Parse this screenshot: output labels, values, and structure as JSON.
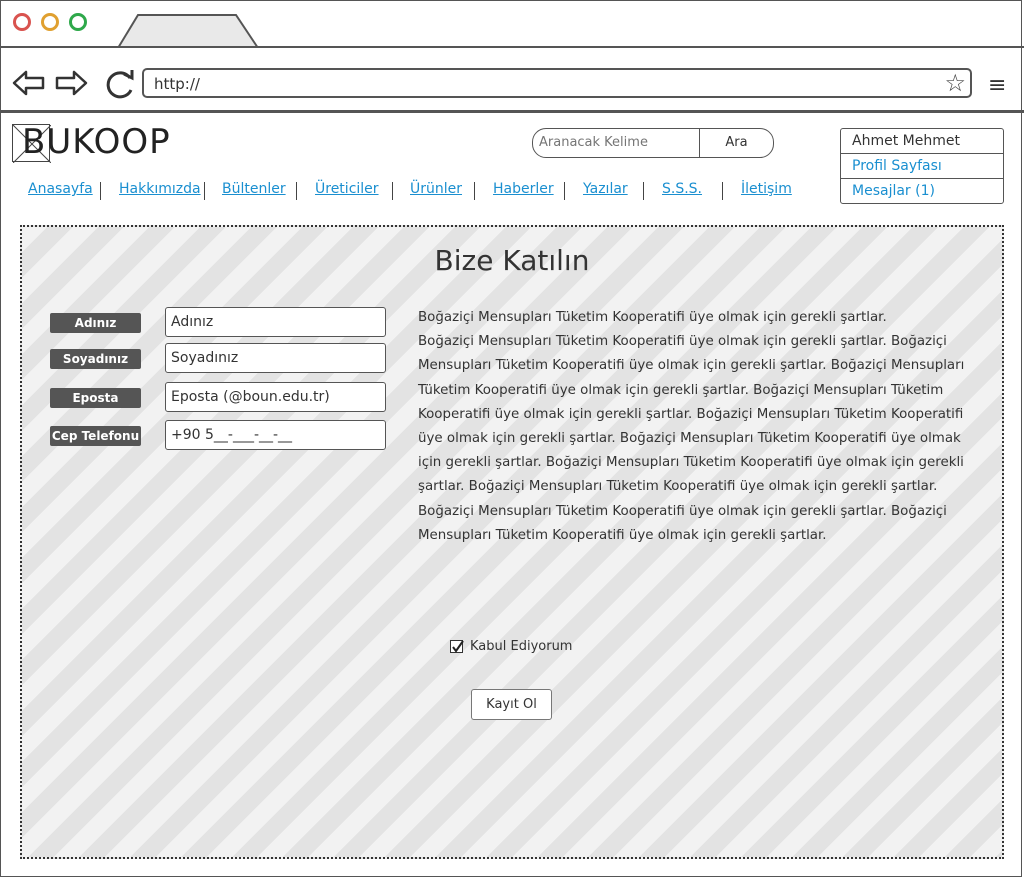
{
  "browser": {
    "url": "http://",
    "icons": [
      "back-arrow-icon",
      "forward-arrow-icon",
      "reload-icon",
      "star-icon",
      "hamburger-menu-icon"
    ]
  },
  "header": {
    "logo_text": "BUKOOP",
    "search": {
      "placeholder": "Aranacak Kelime",
      "button_label": "Ara"
    },
    "user_menu": {
      "name": "Ahmet Mehmet",
      "profile_link": "Profil Sayfası",
      "messages_link": "Mesajlar (1)"
    },
    "nav": [
      {
        "label": "Anasayfa"
      },
      {
        "label": "Hakkımızda"
      },
      {
        "label": "Bültenler"
      },
      {
        "label": "Üreticiler"
      },
      {
        "label": "Ürünler"
      },
      {
        "label": "Haberler"
      },
      {
        "label": "Yazılar"
      },
      {
        "label": "S.S.S."
      },
      {
        "label": "İletişim"
      }
    ]
  },
  "main": {
    "title": "Bize Katılın",
    "form": {
      "fields": [
        {
          "label": "Adınız",
          "value": "Adınız"
        },
        {
          "label": "Soyadınız",
          "value": "Soyadınız"
        },
        {
          "label": "Eposta",
          "value": "Eposta (@boun.edu.tr)"
        },
        {
          "label": "Cep Telefonu",
          "value": "+90 5__-___-__-__"
        }
      ]
    },
    "terms": {
      "line1": "Boğaziçi Mensupları Tüketim Kooperatifi üye olmak için  gerekli şartlar.",
      "body": "Boğaziçi Mensupları Tüketim Kooperatifi  üye olmak için gerekli şartlar. Boğaziçi Mensupları Tüketim Kooperatifi  üye olmak için gerekli şartlar. Boğaziçi Mensupları Tüketim Kooperatifi  üye olmak için gerekli şartlar. Boğaziçi Mensupları Tüketim Kooperatifi  üye olmak için gerekli şartlar. Boğaziçi Mensupları Tüketim Kooperatifi  üye olmak için gerekli şartlar. Boğaziçi Mensupları Tüketim Kooperatifi  üye olmak için gerekli şartlar. Boğaziçi Mensupları Tüketim Kooperatifi  üye olmak için gerekli şartlar. Boğaziçi Mensupları Tüketim Kooperatifi  üye olmak için gerekli şartlar. Boğaziçi Mensupları Tüketim Kooperatifi  üye olmak için gerekli şartlar. Boğaziçi Mensupları Tüketim Kooperatifi  üye olmak için gerekli şartlar."
    },
    "accept_label": "Kabul Ediyorum",
    "accept_checked": true,
    "submit_label": "Kayıt Ol"
  },
  "colors": {
    "link": "#1a8fd0",
    "label_bg": "#555555",
    "dot_red": "#d9534f",
    "dot_orange": "#e0a030",
    "dot_green": "#2ea84a"
  }
}
